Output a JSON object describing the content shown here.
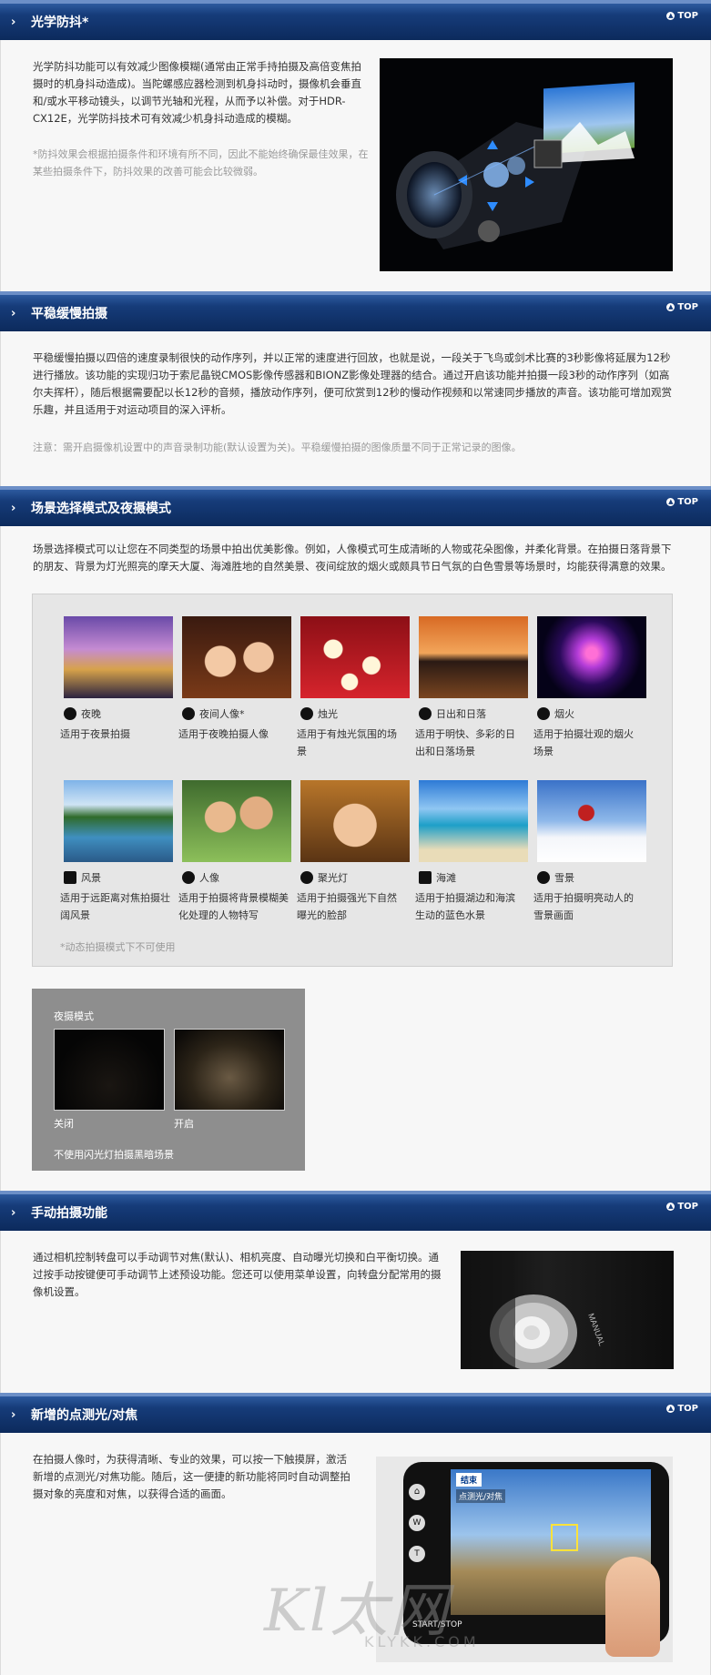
{
  "top_label": "TOP",
  "sections": {
    "stabilizer": {
      "title": "光学防抖*",
      "body": "光学防抖功能可以有效减少图像模糊(通常由正常手持拍摄及高倍变焦拍摄时的机身抖动造成)。当陀螺感应器检测到机身抖动时，摄像机会垂直和/或水平移动镜头，以调节光轴和光程，从而予以补偿。对于HDR-CX12E，光学防抖技术可有效减少机身抖动造成的模糊。",
      "note": "*防抖效果会根据拍摄条件和环境有所不同，因此不能始终确保最佳效果，在某些拍摄条件下，防抖效果的改善可能会比较微弱。"
    },
    "slowmo": {
      "title": "平稳缓慢拍摄",
      "body": "平稳缓慢拍摄以四倍的速度录制很快的动作序列，并以正常的速度进行回放，也就是说，一段关于飞鸟或剑术比赛的3秒影像将延展为12秒进行播放。该功能的实现归功于索尼晶锐CMOS影像传感器和BIONZ影像处理器的结合。通过开启该功能并拍摄一段3秒的动作序列（如高尔夫挥杆），随后根据需要配以长12秒的音频，播放动作序列，便可欣赏到12秒的慢动作视频和以常速同步播放的声音。该功能可增加观赏乐趣，并且适用于对运动项目的深入评析。",
      "note": "注意：需开启摄像机设置中的声音录制功能(默认设置为关)。平稳缓慢拍摄的图像质量不同于正常记录的图像。"
    },
    "scene": {
      "title": "场景选择模式及夜摄模式",
      "body": "场景选择模式可以让您在不同类型的场景中拍出优美影像。例如，人像模式可生成清晰的人物或花朵图像，并柔化背景。在拍摄日落背景下的朋友、背景为灯光照亮的摩天大厦、海滩胜地的自然美景、夜间绽放的烟火或颇具节日气氛的白色雪景等场景时，均能获得满意的效果。",
      "scenes": [
        {
          "label": "夜晚",
          "desc": "适用于夜景拍摄",
          "icon": "moon-icon"
        },
        {
          "label": "夜间人像*",
          "desc": "适用于夜晚拍摄人像",
          "icon": "night-portrait-icon"
        },
        {
          "label": "烛光",
          "desc": "适用于有烛光氛围的场景",
          "icon": "candle-icon"
        },
        {
          "label": "日出和日落",
          "desc": "适用于明快、多彩的日出和日落场景",
          "icon": "sunset-icon"
        },
        {
          "label": "烟火",
          "desc": "适用于拍摄壮观的烟火场景",
          "icon": "fireworks-icon"
        },
        {
          "label": "风景",
          "desc": "适用于远距离对焦拍摄壮阔风景",
          "icon": "landscape-icon"
        },
        {
          "label": "人像",
          "desc": "适用于拍摄将背景模糊美化处理的人物特写",
          "icon": "portrait-icon"
        },
        {
          "label": "聚光灯",
          "desc": "适用于拍摄强光下自然曝光的脸部",
          "icon": "spotlight-icon"
        },
        {
          "label": "海滩",
          "desc": "适用于拍摄湖边和海滨生动的蓝色水景",
          "icon": "beach-icon"
        },
        {
          "label": "雪景",
          "desc": "适用于拍摄明亮动人的雪景画面",
          "icon": "snow-icon"
        }
      ],
      "scene_note": "*动态拍摄模式下不可使用",
      "night": {
        "title": "夜摄模式",
        "off_label": "关闭",
        "on_label": "开启",
        "caption": "不使用闪光灯拍摄黑暗场景"
      }
    },
    "manual": {
      "title": "手动拍摄功能",
      "body": "通过相机控制转盘可以手动调节对焦(默认)、相机亮度、自动曝光切换和白平衡切换。通过按手动按键便可手动调节上述预设功能。您还可以使用菜单设置，向转盘分配常用的摄像机设置。"
    },
    "spot": {
      "title": "新增的点测光/对焦",
      "body": "在拍摄人像时，为获得清晰、专业的效果，可以按一下触摸屏，激活新增的点测光/对焦功能。随后，这一便捷的新功能将同时自动调整拍摄对象的亮度和对焦，以获得合适的画面。",
      "screen_end": "结束",
      "screen_hint": "点测光/对焦",
      "start_stop": "START/STOP"
    }
  },
  "watermark": {
    "brand": "Kl太网",
    "domain": "KLYKK.COM"
  },
  "colors": {
    "header_bg": "#163c7a",
    "panel_bg": "#f7f7f7",
    "note_text": "#999999",
    "grid_bg": "#e6e6e6",
    "night_box_bg": "#8e8e8e"
  }
}
